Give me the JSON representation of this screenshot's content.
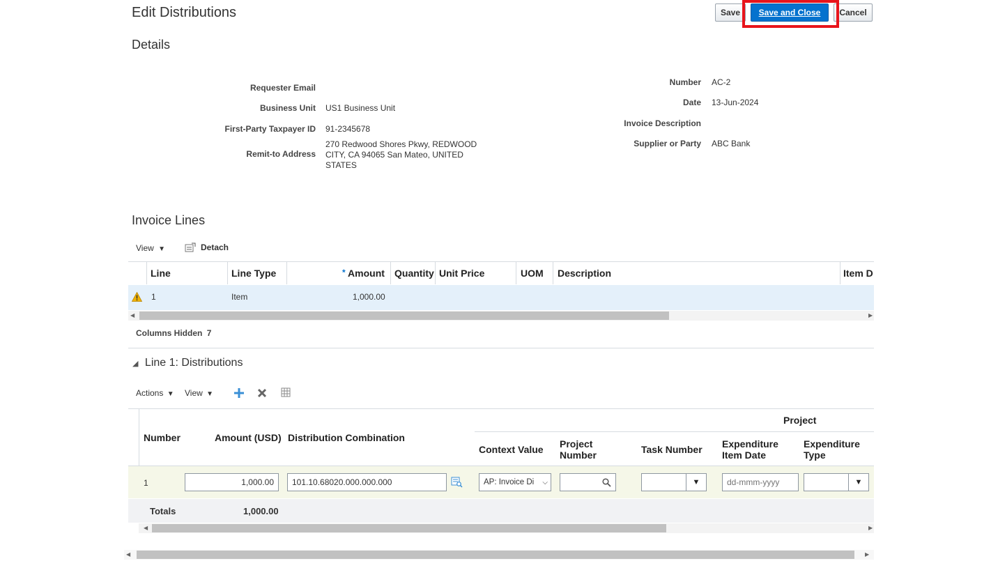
{
  "page": {
    "title": "Edit Distributions"
  },
  "toolbar": {
    "save_label": "Save",
    "save_close_label": "Save and Close",
    "cancel_label": "Cancel"
  },
  "details": {
    "heading": "Details",
    "left": [
      {
        "label": "Requester Email",
        "value": ""
      },
      {
        "label": "Business Unit",
        "value": "US1 Business Unit"
      },
      {
        "label": "First-Party Taxpayer ID",
        "value": "91-2345678"
      },
      {
        "label": "Remit-to Address",
        "value": "270 Redwood Shores Pkwy, REDWOOD CITY, CA 94065 San Mateo, UNITED STATES"
      }
    ],
    "right": [
      {
        "label": "Number",
        "value": "AC-2"
      },
      {
        "label": "Date",
        "value": "13-Jun-2024"
      },
      {
        "label": "Invoice Description",
        "value": ""
      },
      {
        "label": "Supplier or Party",
        "value": "ABC Bank"
      }
    ]
  },
  "invoice_lines": {
    "heading": "Invoice Lines",
    "view_label": "View",
    "detach_label": "Detach",
    "columns": [
      "Line",
      "Line Type",
      "Amount",
      "Quantity",
      "Unit Price",
      "UOM",
      "Description",
      "Item D"
    ],
    "required_marker": "*",
    "rows": [
      {
        "line": "1",
        "line_type": "Item",
        "amount": "1,000.00"
      }
    ],
    "columns_hidden_label": "Columns Hidden",
    "columns_hidden_count": "7"
  },
  "distributions": {
    "heading": "Line 1: Distributions",
    "actions_label": "Actions",
    "view_label": "View",
    "group_header": "Project",
    "columns": [
      "Number",
      "Amount (USD)",
      "Distribution Combination",
      "Context Value",
      "Project Number",
      "Task Number",
      "Expenditure Item Date",
      "Expenditure Type"
    ],
    "row": {
      "number": "1",
      "amount": "1,000.00",
      "combination": "101.10.68020.000.000.000",
      "context_value": "AP: Invoice Di",
      "project_number": "",
      "task_number": "",
      "expenditure_date_placeholder": "dd-mmm-yyyy",
      "expenditure_type": ""
    },
    "totals_label": "Totals",
    "totals_value": "1,000.00"
  },
  "colors": {
    "primary": "#0572ce",
    "highlight": "#e8141b",
    "selected_row": "#e4f0fa",
    "warning": "#f2b300"
  }
}
